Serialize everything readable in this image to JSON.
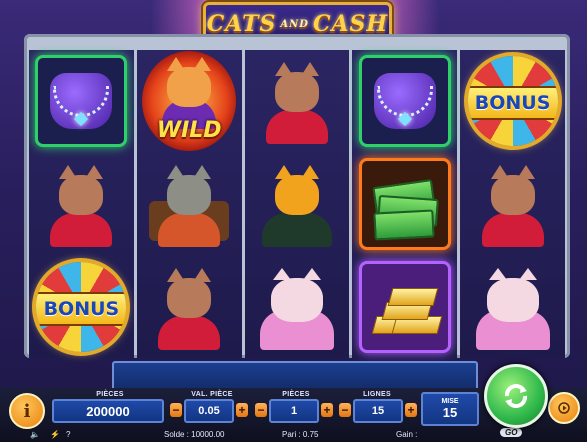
{
  "game": {
    "title_part1": "CATS",
    "title_and": "AND",
    "title_part2": "CASH"
  },
  "symbols": {
    "wild_label": "WILD",
    "bonus_label": "BONUS"
  },
  "reels": [
    [
      "jewelry-bag",
      "bonus-wheel",
      "cat-lady",
      "bonus-wheel"
    ],
    [
      "wild-cat",
      "businessman-cat",
      "cat-lady"
    ],
    [
      "cat-lady",
      "tiger-boss-cat",
      "persian-cat"
    ],
    [
      "jewelry-bag",
      "cash-stack",
      "gold-bars"
    ],
    [
      "bonus-wheel",
      "cat-lady",
      "persian-cat"
    ]
  ],
  "controls": {
    "coins_label": "PIÈCES",
    "coins_value": "200000",
    "coin_value_label": "VAL. PIÈCE",
    "coin_value": "0.05",
    "pieces_label": "PIÈCES",
    "pieces_value": "1",
    "lines_label": "LIGNES",
    "lines_value": "15",
    "bet_label": "MISE",
    "bet_value": "15",
    "minus": "−",
    "plus": "+",
    "info_glyph": "i"
  },
  "status": {
    "balance": "Solde : 10000.00",
    "bet": "Pari : 0.75",
    "win": "Gain :",
    "provider": "GO"
  },
  "colors": {
    "accent": "#f39a1d",
    "spin": "#2fb84b",
    "panel": "#1f4aa8"
  }
}
